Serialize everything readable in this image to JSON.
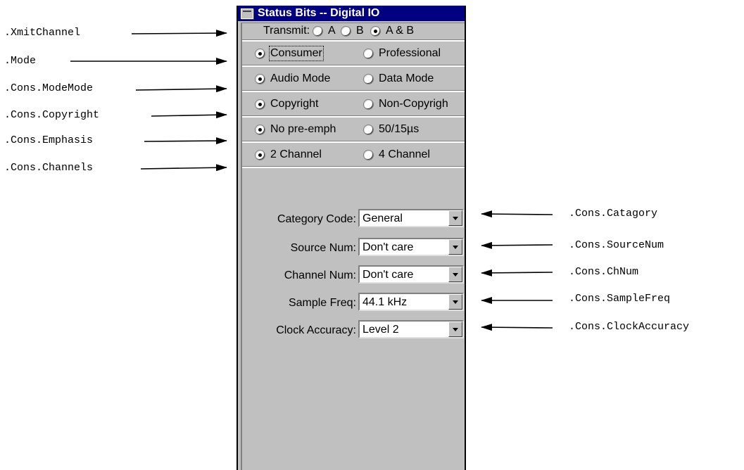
{
  "window": {
    "title": "Status Bits -- Digital IO"
  },
  "transmit": {
    "label": "Transmit:",
    "options": [
      "A",
      "B",
      "A & B"
    ],
    "selected": "A & B"
  },
  "mode": {
    "options": [
      "Consumer",
      "Professional"
    ],
    "selected": "Consumer"
  },
  "modemode": {
    "options": [
      "Audio Mode",
      "Data Mode"
    ],
    "selected": "Audio Mode"
  },
  "copyright": {
    "options": [
      "Copyright",
      "Non-Copyrigh"
    ],
    "selected": "Copyright"
  },
  "emphasis": {
    "options": [
      "No pre-emph",
      "50/15µs"
    ],
    "selected": "No pre-emph"
  },
  "channels": {
    "options": [
      "2 Channel",
      "4 Channel"
    ],
    "selected": "2 Channel"
  },
  "fields": [
    {
      "label": "Category Code:",
      "value": "General"
    },
    {
      "label": "Source Num:",
      "value": "Don't care"
    },
    {
      "label": "Channel Num:",
      "value": "Don't care"
    },
    {
      "label": "Sample Freq:",
      "value": "44.1 kHz"
    },
    {
      "label": "Clock Accuracy:",
      "value": "Level 2"
    }
  ],
  "annotations": {
    "left": [
      ".XmitChannel",
      ".Mode",
      ".Cons.ModeMode",
      ".Cons.Copyright",
      ".Cons.Emphasis",
      ".Cons.Channels"
    ],
    "right": [
      ".Cons.Catagory",
      ".Cons.SourceNum",
      ".Cons.ChNum",
      ".Cons.SampleFreq",
      ".Cons.ClockAccuracy"
    ]
  }
}
